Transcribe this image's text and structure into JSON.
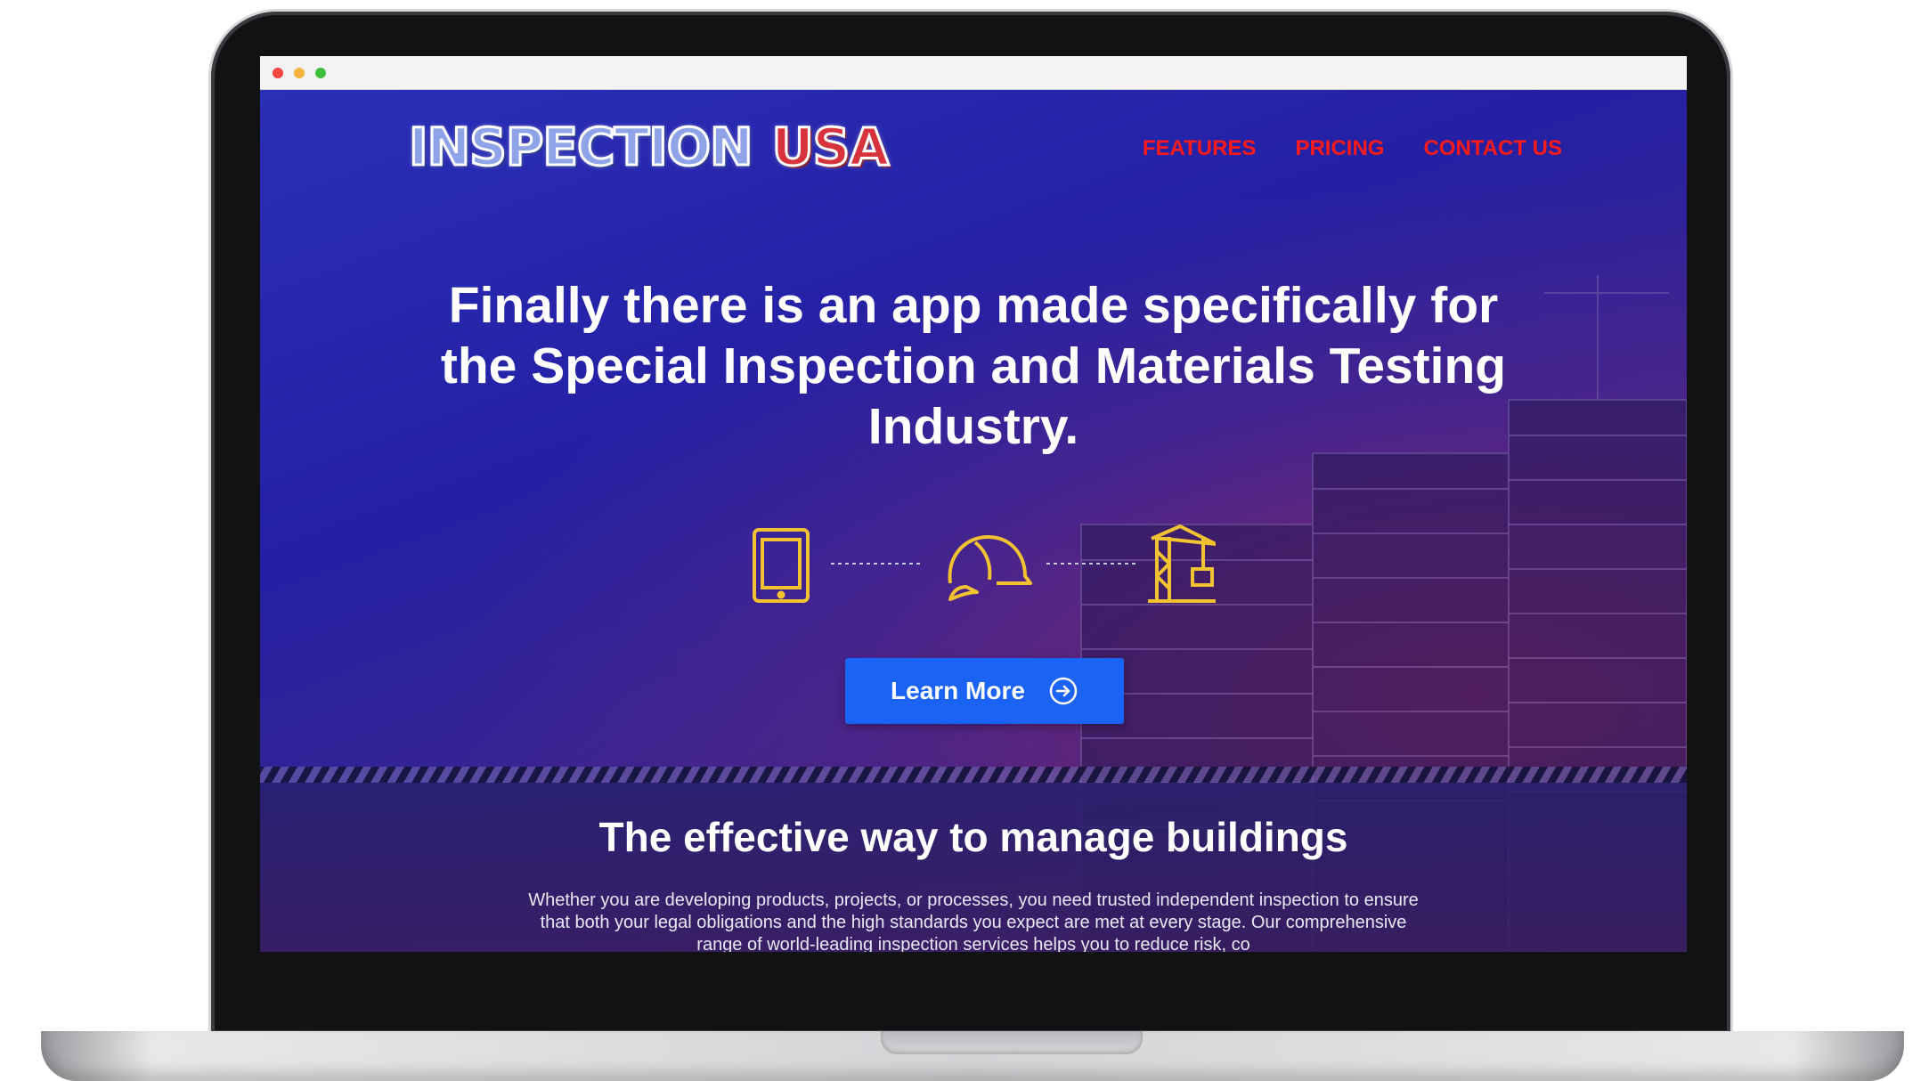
{
  "browser": {
    "controls": [
      "close",
      "minimize",
      "zoom"
    ]
  },
  "header": {
    "logo": {
      "part_1": "INSPECTION",
      "part_2": "USA"
    },
    "nav": [
      {
        "label": "FEATURES"
      },
      {
        "label": "PRICING"
      },
      {
        "label": "CONTACT US"
      }
    ]
  },
  "hero": {
    "title": "Finally there is an app made specifically for the Special Inspection and Materials Testing Industry.",
    "icons": [
      "tablet-icon",
      "hard-hat-icon",
      "crane-icon"
    ],
    "cta_label": "Learn More",
    "cta_icon": "arrow-circle-right-icon"
  },
  "section": {
    "title": "The effective way to manage buildings",
    "body": "Whether you are developing products, projects, or processes, you need trusted independent inspection to ensure that both your legal obligations and the high standards you expect are met at every stage. Our comprehensive range of world-leading inspection services helps you to reduce risk, co"
  },
  "colors": {
    "nav_link": "#ff1a1a",
    "cta_background": "#1a63f5",
    "icon_accent": "#f2c230",
    "hero_background": "#2420a4"
  }
}
